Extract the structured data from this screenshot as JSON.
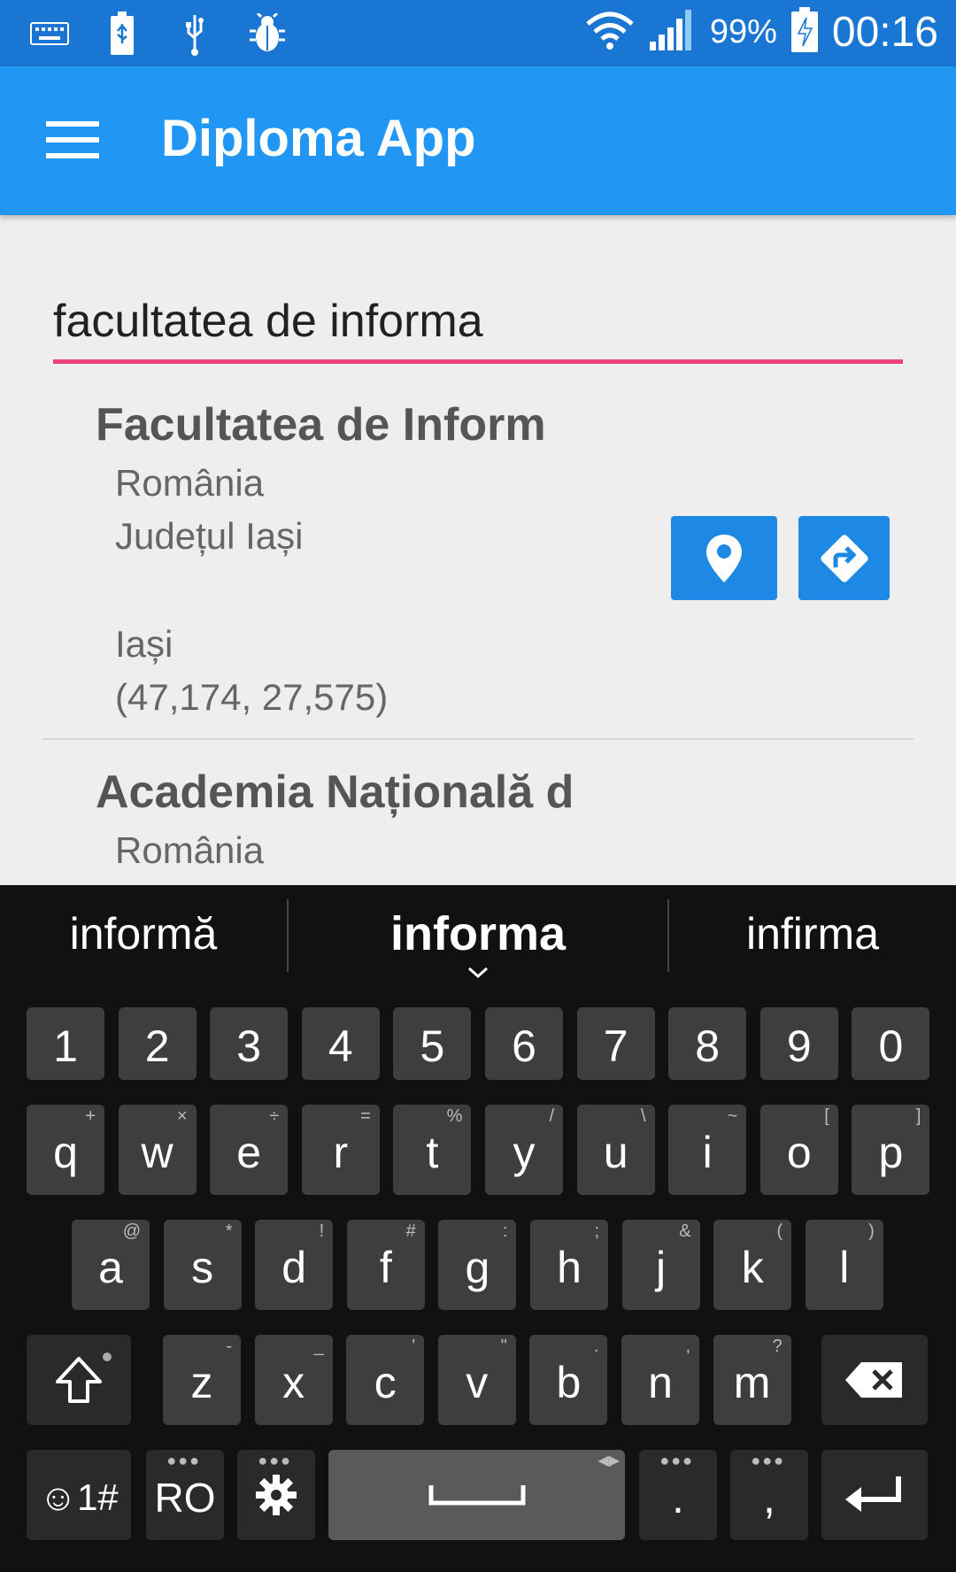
{
  "status_bar": {
    "battery_percent": "99%",
    "time": "00:16",
    "icons": [
      "keyboard-icon",
      "battery-usb-icon",
      "usb-icon",
      "bug-icon",
      "wifi-icon",
      "signal-icon",
      "battery-charging-icon"
    ]
  },
  "app_bar": {
    "title": "Diploma App",
    "menu_icon": "hamburger-menu-icon"
  },
  "search": {
    "value": "facultatea de informa"
  },
  "results": [
    {
      "title": "Facultatea de Inform",
      "country": "România",
      "county": "Județul Iași",
      "city": "Iași",
      "coords": "(47,174, 27,575)",
      "buttons": [
        "map-pin-icon",
        "directions-icon"
      ]
    },
    {
      "title": "Academia Națională d",
      "country": "România"
    }
  ],
  "keyboard": {
    "suggestions": [
      "informă",
      "informa",
      "infirma"
    ],
    "number_row": [
      "1",
      "2",
      "3",
      "4",
      "5",
      "6",
      "7",
      "8",
      "9",
      "0"
    ],
    "row1": [
      {
        "k": "q",
        "h": "+"
      },
      {
        "k": "w",
        "h": "×"
      },
      {
        "k": "e",
        "h": "÷"
      },
      {
        "k": "r",
        "h": "="
      },
      {
        "k": "t",
        "h": "%"
      },
      {
        "k": "y",
        "h": "/"
      },
      {
        "k": "u",
        "h": "\\"
      },
      {
        "k": "i",
        "h": "~"
      },
      {
        "k": "o",
        "h": "["
      },
      {
        "k": "p",
        "h": "]"
      }
    ],
    "row2": [
      {
        "k": "a",
        "h": "@"
      },
      {
        "k": "s",
        "h": "*"
      },
      {
        "k": "d",
        "h": "!"
      },
      {
        "k": "f",
        "h": "#"
      },
      {
        "k": "g",
        "h": ":"
      },
      {
        "k": "h",
        "h": ";"
      },
      {
        "k": "j",
        "h": "&"
      },
      {
        "k": "k",
        "h": "("
      },
      {
        "k": "l",
        "h": ")"
      }
    ],
    "row3": [
      {
        "k": "z",
        "h": "-"
      },
      {
        "k": "x",
        "h": "_"
      },
      {
        "k": "c",
        "h": "'"
      },
      {
        "k": "v",
        "h": "\""
      },
      {
        "k": "b",
        "h": "."
      },
      {
        "k": "n",
        "h": ","
      },
      {
        "k": "m",
        "h": "?"
      }
    ],
    "symbols_label": "☺1#",
    "language_label": "RO",
    "period": ".",
    "comma": ","
  }
}
